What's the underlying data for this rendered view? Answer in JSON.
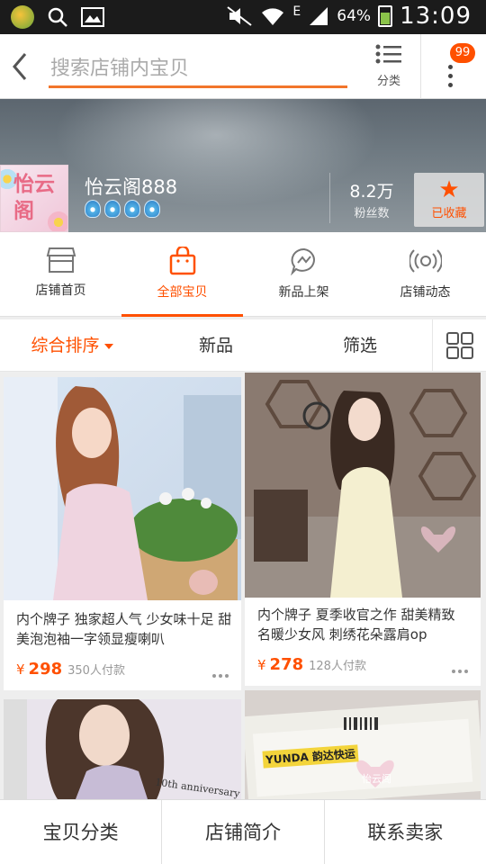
{
  "status_bar": {
    "battery": "64%",
    "time": "13:09",
    "network": "E"
  },
  "search": {
    "placeholder": "搜索店铺内宝贝",
    "category_label": "分类",
    "notification_count": "99"
  },
  "shop": {
    "logo_text": "怡云阁",
    "name": "怡云阁888",
    "crown_count": 4,
    "fans_count": "8.2万",
    "fans_label": "粉丝数",
    "favorite_label": "已收藏"
  },
  "tabs": [
    {
      "label": "店铺首页",
      "icon": "shop-icon",
      "active": false
    },
    {
      "label": "全部宝贝",
      "icon": "bag-icon",
      "active": true
    },
    {
      "label": "新品上架",
      "icon": "new-arrivals-icon",
      "active": false
    },
    {
      "label": "店铺动态",
      "icon": "broadcast-icon",
      "active": false
    }
  ],
  "sort": {
    "default_label": "综合排序",
    "new_label": "新品",
    "filter_label": "筛选"
  },
  "products": [
    {
      "title": "内个牌子 独家超人气 少女味十足 甜美泡泡袖一字领显瘦喇叭",
      "currency": "¥",
      "price": "298",
      "sales": "350人付款",
      "watermark": "怡云阁"
    },
    {
      "title": "内个牌子 夏季收官之作 甜美精致 名暖少女风 刺绣花朵露肩op",
      "currency": "¥",
      "price": "278",
      "sales": "128人付款",
      "watermark": "怡云阁"
    },
    {
      "title": "",
      "currency": "",
      "price": "",
      "sales": "",
      "watermark": "",
      "image_text": "10th anniversary"
    },
    {
      "title": "",
      "currency": "",
      "price": "",
      "sales": "",
      "watermark": "怡云阁",
      "image_text": "YUNDA 韵达快运"
    }
  ],
  "bottom_bar": {
    "categories_label": "宝贝分类",
    "intro_label": "店铺简介",
    "contact_label": "联系卖家"
  },
  "colors": {
    "accent": "#ff5000",
    "search_underline": "#f2752b"
  }
}
